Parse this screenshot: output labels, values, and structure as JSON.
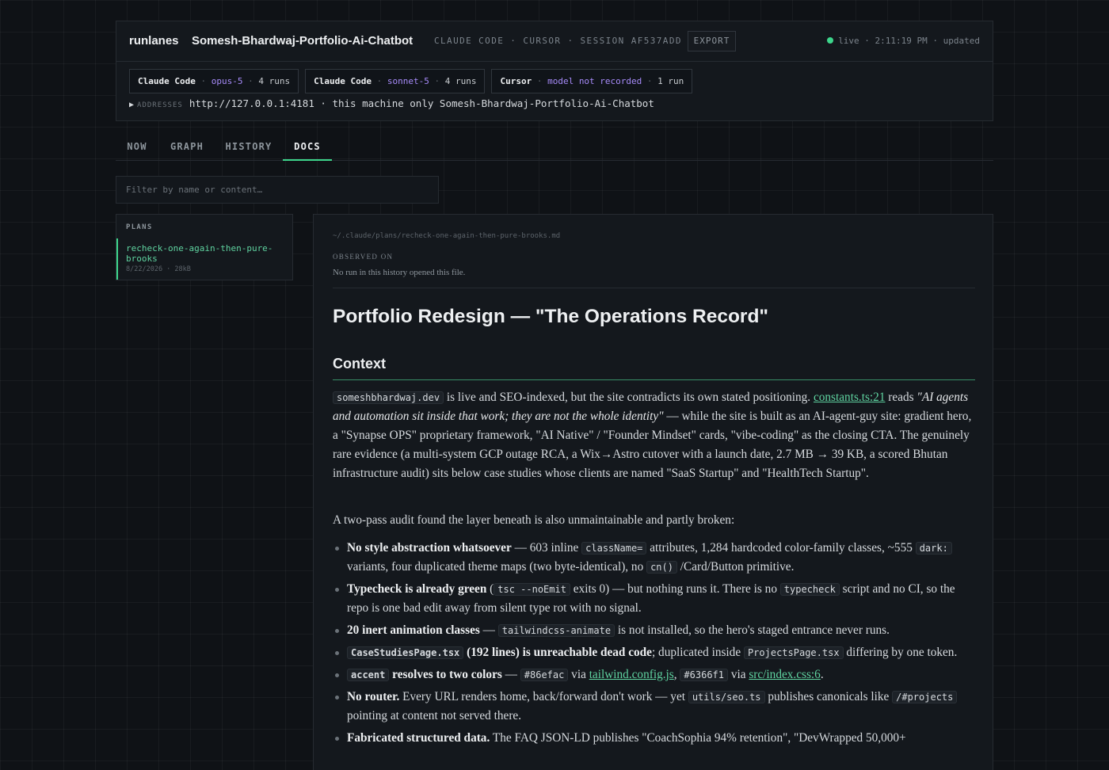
{
  "header": {
    "brand": "runlanes",
    "repo": "Somesh-Bhardwaj-Portfolio-Ai-Chatbot",
    "meta": "CLAUDE CODE · CURSOR · SESSION AF537ADD",
    "export_label": "EXPORT",
    "status": "live · 2:11:19 PM · updated",
    "status_color": "#3dd68c"
  },
  "pills": [
    {
      "agent": "Claude Code",
      "model": "opus-5",
      "runs": "4 runs"
    },
    {
      "agent": "Claude Code",
      "model": "sonnet-5",
      "runs": "4 runs"
    },
    {
      "agent": "Cursor",
      "model": "model not recorded",
      "runs": "1 run"
    }
  ],
  "addresses": {
    "label": "ADDRESSES",
    "url": "http://127.0.0.1:4181",
    "scope": "· this machine only",
    "repo": "Somesh-Bhardwaj-Portfolio-Ai-Chatbot"
  },
  "tabs": {
    "now": "NOW",
    "graph": "GRAPH",
    "history": "HISTORY",
    "docs": "DOCS",
    "active": "DOCS"
  },
  "filter": {
    "placeholder": "Filter by name or content…"
  },
  "plans": {
    "heading": "PLANS",
    "items": [
      {
        "name": "recheck-one-again-then-pure-brooks",
        "date": "8/22/2026",
        "size": "28kB"
      }
    ]
  },
  "doc": {
    "path": "~/.claude/plans/recheck-one-again-then-pure-brooks.md",
    "observed_label": "OBSERVED ON",
    "observed_text": "No run in this history opened this file.",
    "title": "Portfolio Redesign — \"The Operations Record\"",
    "section": "Context",
    "p1": {
      "code1": "someshbhardwaj.dev",
      "t1": " is live and SEO-indexed, but the site contradicts its own stated positioning. ",
      "link1": "constants.ts:21",
      "t2": " reads ",
      "quote": "\"AI agents and automation sit inside that work; they are not the whole identity\"",
      "t3": " — while the site is built as an AI-agent-guy site: gradient hero, a \"Synapse OPS\" proprietary framework, \"AI Native\" / \"Founder Mindset\" cards, \"vibe-coding\" as the closing CTA. The genuinely rare evidence (a multi-system GCP outage RCA, a Wix→Astro cutover with a launch date, 2.7 MB → 39 KB, a scored Bhutan infrastructure audit) sits below case studies whose clients are named \"SaaS Startup\" and \"HealthTech Startup\"."
    },
    "p2": "A two-pass audit found the layer beneath is also unmaintainable and partly broken:",
    "b1": {
      "bold": "No style abstraction whatsoever",
      "t1": " — 603 inline ",
      "c1": "className=",
      "t2": " attributes, 1,284 hardcoded color-family classes, ~555 ",
      "c2": "dark:",
      "t3": " variants, four duplicated theme maps (two byte-identical), no ",
      "c3": "cn()",
      "t4": " /Card/Button primitive."
    },
    "b2": {
      "bold": "Typecheck is already green",
      "t1": " (",
      "c1": "tsc --noEmit",
      "t2": " exits 0) — but nothing runs it. There is no ",
      "c2": "typecheck",
      "t3": " script and no CI, so the repo is one bad edit away from silent type rot with no signal."
    },
    "b3": {
      "bold": "20 inert animation classes",
      "t1": " — ",
      "c1": "tailwindcss-animate",
      "t2": " is not installed, so the hero's staged entrance never runs."
    },
    "b4": {
      "c1": "CaseStudiesPage.tsx",
      "bold": " (192 lines) is unreachable dead code",
      "t1": "; duplicated inside ",
      "c2": "ProjectsPage.tsx",
      "t2": " differing by one token."
    },
    "b5": {
      "c1": "accent",
      "bold": " resolves to two colors",
      "t1": " — ",
      "c2": "#86efac",
      "t2": " via ",
      "link1": "tailwind.config.js",
      "t3": ", ",
      "c3": "#6366f1",
      "t4": " via ",
      "link2": "src/index.css:6",
      "t5": "."
    },
    "b6": {
      "bold": "No router.",
      "t1": " Every URL renders home, back/forward don't work — yet ",
      "c1": "utils/seo.ts",
      "t2": " publishes canonicals like ",
      "c2": "/#projects",
      "t3": " pointing at content not served there."
    },
    "b7": {
      "bold": "Fabricated structured data.",
      "t1": " The FAQ JSON-LD publishes \"CoachSophia 94% retention\", \"DevWrapped 50,000+"
    }
  },
  "colors": {
    "accent_green": "#3dd68c",
    "model_purple": "#a78bfa",
    "background": "#0f1216"
  }
}
